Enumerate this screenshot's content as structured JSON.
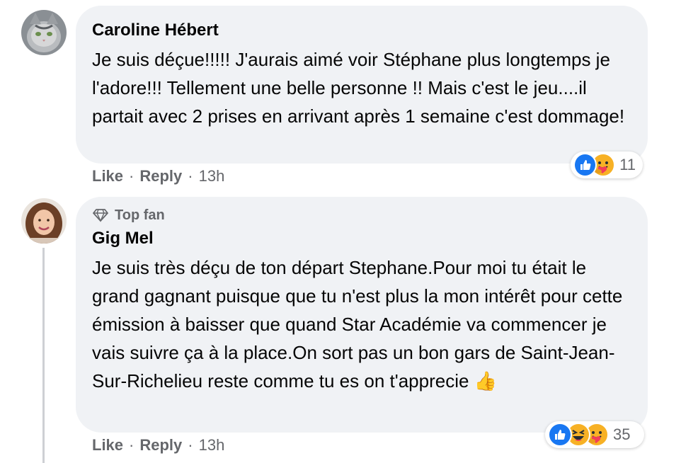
{
  "comments": [
    {
      "author": "Caroline Hébert",
      "avatar": "cat-avatar",
      "text": "Je suis déçue!!!!! J'aurais aimé voir Stéphane plus longtemps je l'adore!!! Tellement une belle personne !! Mais c'est le jeu....il partait avec 2 prises en arrivant après 1 semaine c'est dommage!",
      "actions": {
        "like": "Like",
        "reply": "Reply",
        "time": "13h"
      },
      "reactions": {
        "icons": [
          "like",
          "care"
        ],
        "count": "11"
      }
    },
    {
      "badge": "Top fan",
      "author": "Gig Mel",
      "avatar": "woman-avatar",
      "text": "Je suis très déçu de ton départ Stephane.Pour moi tu était le grand gagnant puisque que tu n'est plus la mon intérêt pour cette émission à baisser que quand Star Académie va commencer je vais suivre ça à la place.On sort pas un bon gars de Saint-Jean-Sur-Richelieu reste comme tu es on t'apprecie 👍",
      "actions": {
        "like": "Like",
        "reply": "Reply",
        "time": "13h"
      },
      "reactions": {
        "icons": [
          "like",
          "haha",
          "care"
        ],
        "count": "35"
      }
    }
  ],
  "separator": "·",
  "colors": {
    "bubble": "#f0f2f5",
    "secondary_text": "#65676b",
    "like_blue": "#1877f2",
    "emoji_yellow": "#f7b125"
  }
}
